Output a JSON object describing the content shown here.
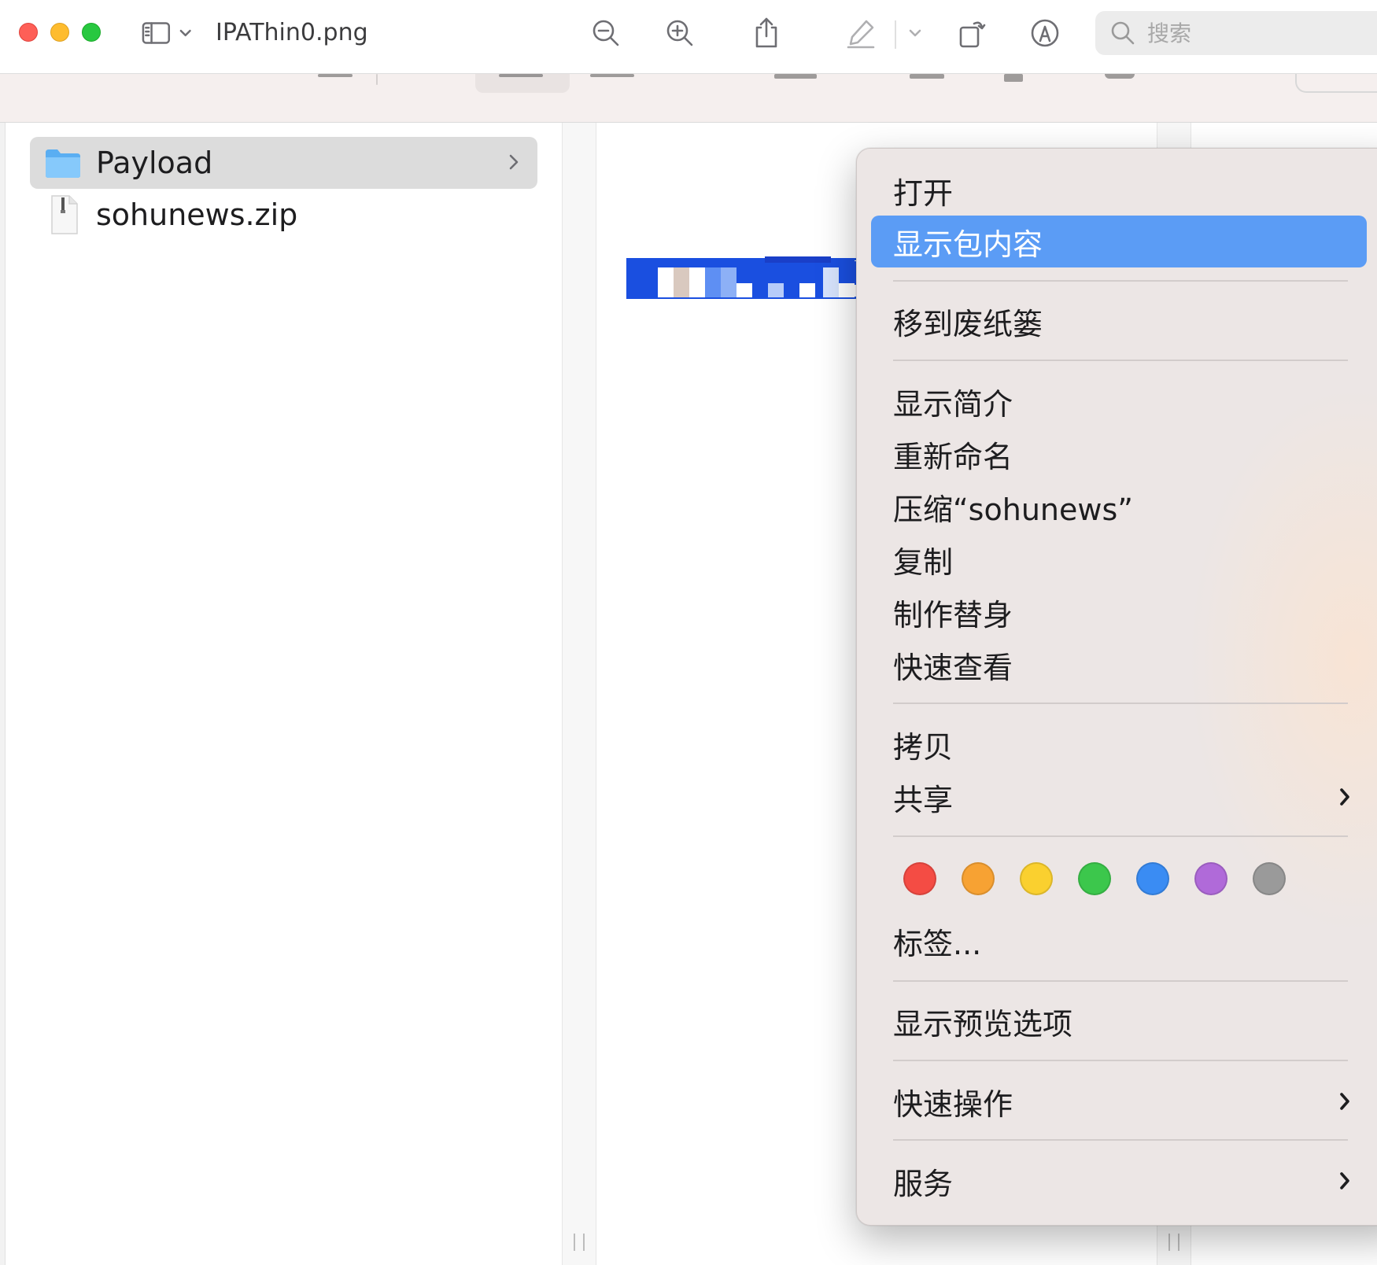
{
  "window": {
    "title": "IPAThin0.png",
    "search_placeholder": "搜索",
    "toolbar_icons": [
      "sidebar-icon",
      "chevron-down-icon",
      "zoom-out-icon",
      "zoom-in-icon",
      "share-icon",
      "markup-pen-icon",
      "chevron-down-icon",
      "rotate-icon",
      "annotate-icon",
      "search-icon"
    ]
  },
  "finder": {
    "items": [
      {
        "label": "Payload",
        "icon": "folder-icon",
        "selected": true
      },
      {
        "label": "sohunews.zip",
        "icon": "zip-file-icon",
        "selected": false
      }
    ]
  },
  "context_menu": {
    "open": "打开",
    "show_package_contents": "显示包内容",
    "move_to_trash": "移到废纸篓",
    "get_info": "显示简介",
    "rename": "重新命名",
    "compress": "压缩“sohunews”",
    "duplicate": "复制",
    "make_alias": "制作替身",
    "quick_look": "快速查看",
    "copy": "拷贝",
    "share": "共享",
    "tag_colors": [
      {
        "name": "red",
        "color": "#f44c44"
      },
      {
        "name": "orange",
        "color": "#f7a233"
      },
      {
        "name": "yellow",
        "color": "#fad02f"
      },
      {
        "name": "green",
        "color": "#3cc74c"
      },
      {
        "name": "blue",
        "color": "#3a8cf3"
      },
      {
        "name": "purple",
        "color": "#b06ad9"
      },
      {
        "name": "gray",
        "color": "#9a9a9a"
      }
    ],
    "tags": "标签...",
    "show_preview_options": "显示预览选项",
    "quick_actions": "快速操作",
    "services": "服务",
    "highlight_color": "#5b9cf5"
  }
}
